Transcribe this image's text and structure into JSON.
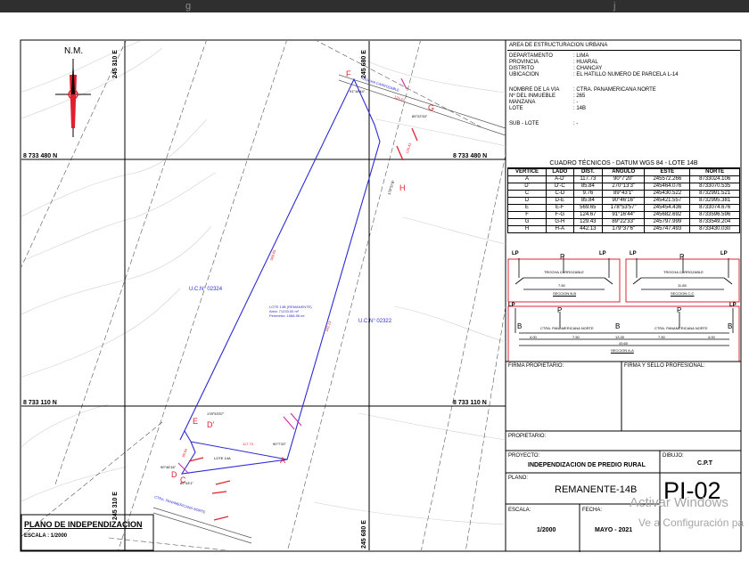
{
  "topbar": {
    "fragments": [
      "g",
      "j"
    ]
  },
  "map": {
    "north_label": "N.M.",
    "coords": {
      "e1": "245 310 E",
      "e2": "245 680 E",
      "n1_left": "8 733 480 N",
      "n1_right": "8 733 480 N",
      "n2_left": "8 733 110 N",
      "n2_right": "8 733 110 N",
      "e1_bottom": "245 310 E",
      "e2_bottom": "245 680 E"
    },
    "parcel_left": "U.C.N° 02324",
    "parcel_right": "U.C.N° 02322",
    "center_note": [
      "LOTE 14B (REMANENTE)",
      "Area: 71233.00 m²",
      "Perimetro: 1568.98 ml"
    ],
    "lote_small": "LOTE 14A",
    "road_top": "TROCHA CARROZABLE",
    "road_bottom": "CTRA. PANAMERICANA NORTE",
    "road_right": "TROCHA CARROZABLE",
    "vertices": {
      "A": "A",
      "B": "B",
      "C": "C",
      "D": "D",
      "D_prime": "D'",
      "E": "E",
      "F": "F",
      "G": "G",
      "H": "H"
    },
    "side_labels": {
      "ef": "569.65",
      "ha": "442.13",
      "gh": "129.43",
      "fg": "124.67",
      "ad": "117.73",
      "dc": "85.84",
      "cd": "9.76",
      "de": "85.84"
    },
    "angle_labels": {
      "f": "91°16'44\"",
      "g": "89°22'33\"",
      "h": "179°37'6\"",
      "e": "178°53'57\"",
      "a": "90°7'20\"",
      "c": "89°43'1\"",
      "d": "90°46'16\"",
      "dp": "270°13'3\""
    },
    "boundary_notes": {
      "top_left": "Propiedad Tercero",
      "bottom_right": "Propiedad Tercero"
    }
  },
  "title_block": {
    "title": "PLANO DE INDEPENDIZACION",
    "scale": "ESCALA : 1/2000"
  },
  "info": {
    "header": "AREA DE ESTRUCTURACION URBANA",
    "rows": [
      {
        "k": "DEPARTAMENTO",
        "v": ": LIMA"
      },
      {
        "k": "PROVINCIA",
        "v": ": HUARAL"
      },
      {
        "k": "DISTRITO",
        "v": ": CHANCAY"
      },
      {
        "k": "UBICACION",
        "v": ": EL HATILLO NUMERO DE PARCELA L-14"
      }
    ],
    "rows2": [
      {
        "k": "NOMBRE DE LA VIA",
        "v": ": CTRA. PANAMERICANA NORTE"
      },
      {
        "k": "Nº DEL INMUEBLE",
        "v": ": 265"
      },
      {
        "k": "MANZANA",
        "v": ": -"
      },
      {
        "k": "LOTE",
        "v": ": 14B"
      }
    ],
    "sublote": {
      "k": "SUB - LOTE",
      "v": ": -"
    }
  },
  "cuadro": {
    "title": "CUADRO TÉCNICOS - DATUM WGS 84 - LOTE 14B",
    "headers": [
      "VERTICE",
      "LADO",
      "DIST.",
      "ANGULO",
      "ESTE",
      "NORTE"
    ],
    "rows": [
      [
        "A",
        "A-D'",
        "117.73",
        "90°7'20\"",
        "245572.266",
        "8733024.106"
      ],
      [
        "D'",
        "D'-C",
        "85.84",
        "270°13'3\"",
        "245464.076",
        "8733070.535"
      ],
      [
        "C",
        "C-D",
        "9.76",
        "89°43'1\"",
        "245430.522",
        "8732991.521"
      ],
      [
        "D",
        "D-E",
        "85.84",
        "90°46'16\"",
        "245421.557",
        "8732995.381"
      ],
      [
        "E",
        "E-F",
        "569.65",
        "178°53'57\"",
        "245454.436",
        "8733074.676"
      ],
      [
        "F",
        "F-G",
        "124.67",
        "91°16'44\"",
        "245682.692",
        "8733596.596"
      ],
      [
        "G",
        "G-H",
        "129.43",
        "89°22'33\"",
        "245797.999",
        "8733549.204"
      ],
      [
        "H",
        "H-A",
        "442.13",
        "179°37'6\"",
        "245747.493",
        "8733430.030"
      ]
    ]
  },
  "sections": {
    "lp": "LP",
    "p": "P",
    "b": "B",
    "bc_road": "TROCHA CARROZABLE",
    "bc_width": "7.50",
    "bc_name": "SECCION B-B",
    "cc_road": "TROCHA CARROZABLE",
    "cc_width": "11.85",
    "cc_name": "SECCION C-C",
    "aa_road1": "CTRA. PANAMERICANA NORTE",
    "aa_road2": "CTRA. PANAMERICANA NORTE",
    "aa_dims": [
      "4.00",
      "7.50",
      "13.30",
      "7.50",
      "4.00"
    ],
    "aa_total": "43.60",
    "aa_name": "SECCION A-A"
  },
  "footer": {
    "firma_propietario": "FIRMA PROPIETARIO:",
    "firma_profesional": "FIRMA Y SELLO PROFESIONAL:",
    "propietario": "PROPIETARIO:",
    "proyecto_label": "PROYECTO:",
    "proyecto_value": "INDEPENDIZACION DE PREDIO RURAL",
    "dibujo_label": "DIBUJO:",
    "dibujo_value": "C.P.T",
    "plano_label": "PLANO:",
    "plano_value": "REMANENTE-14B",
    "escala_label": "ESCALA:",
    "escala_value": "1/2000",
    "fecha_label": "FECHA:",
    "fecha_value": "MAYO - 2021",
    "sheet_code": "PI-02"
  },
  "watermark": {
    "line1": "Activar Windows",
    "line2": "Ve a Configuración pa"
  }
}
